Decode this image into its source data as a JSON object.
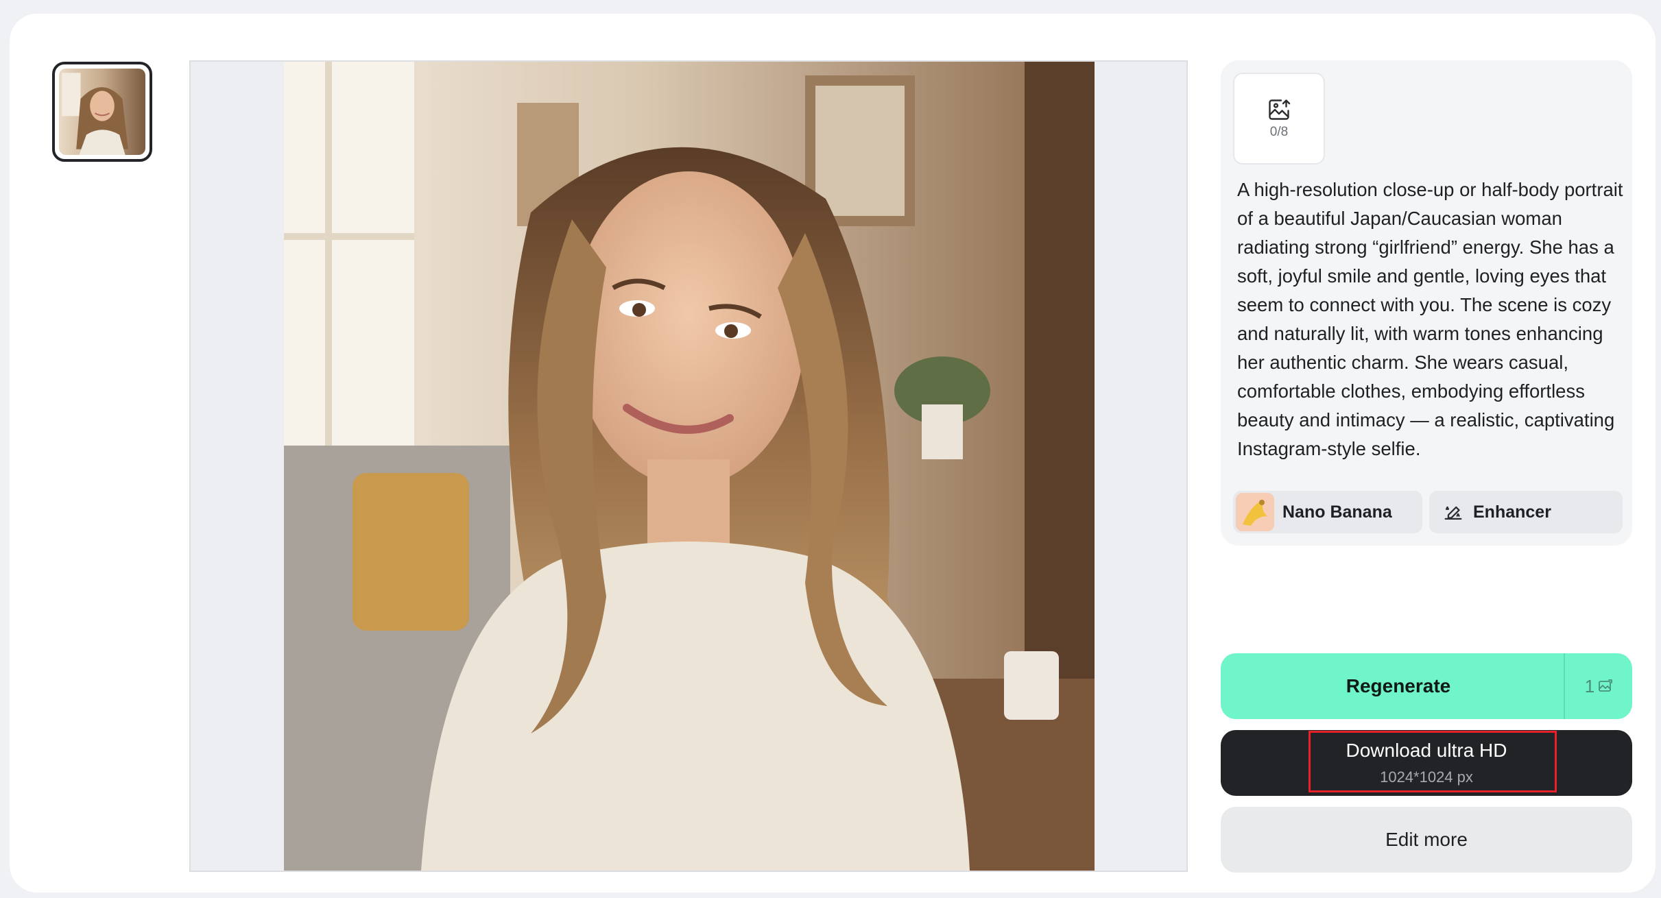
{
  "thumbnails": [
    {
      "icon": "portrait-thumbnail"
    }
  ],
  "viewer": {
    "image_icon": "portrait-image"
  },
  "upload": {
    "icon": "image-upload-icon",
    "count": "0/8"
  },
  "prompt": {
    "text": "A high-resolution close-up or half-body portrait of a beautiful Japan/Caucasian woman radiating strong “girlfriend” energy. She has a soft, joyful smile and gentle, loving eyes that seem to connect with you. The scene is cozy and naturally lit, with warm tones enhancing her authentic charm. She wears casual, comfortable clothes, embodying effortless beauty and intimacy — a realistic, captivating Instagram-style selfie."
  },
  "chips": {
    "model_label": "Nano Banana",
    "enhancer_label": "Enhancer"
  },
  "actions": {
    "regenerate_label": "Regenerate",
    "regenerate_cost": "1",
    "download_label": "Download ultra HD",
    "download_resolution": "1024*1024 px",
    "edit_label": "Edit more"
  },
  "colors": {
    "regenerate_bg": "#6ff5c9",
    "download_bg": "#212327",
    "highlight_border": "#e8202a"
  }
}
